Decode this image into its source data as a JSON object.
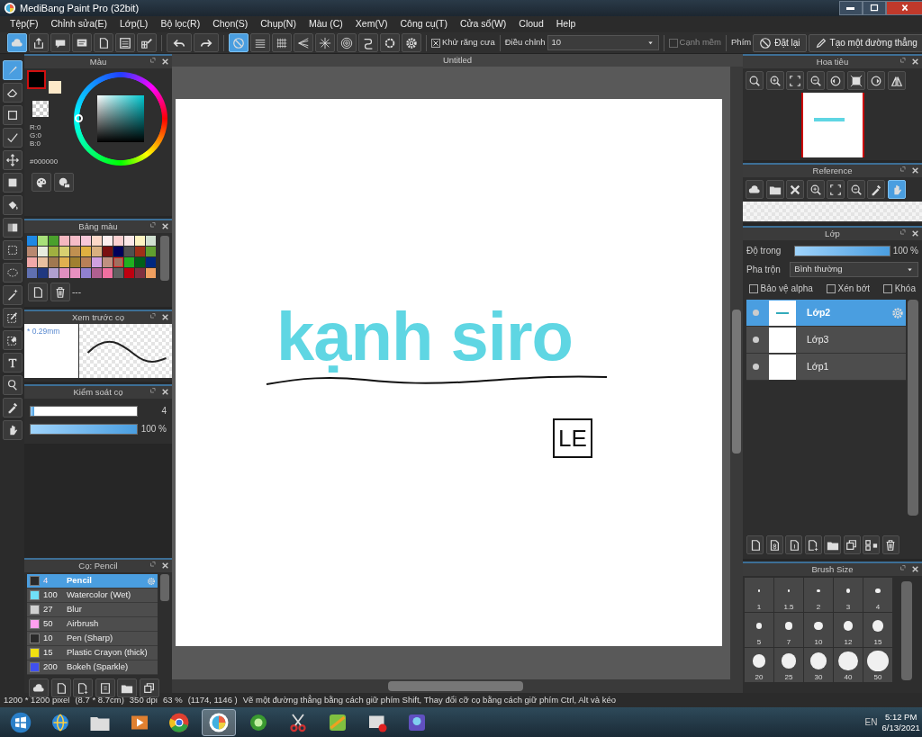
{
  "window": {
    "title": "MediBang Paint Pro (32bit)"
  },
  "menu": [
    "Tệp(F)",
    "Chỉnh sửa(E)",
    "Lớp(L)",
    "Bộ lọc(R)",
    "Chọn(S)",
    "Chụp(N)",
    "Màu (C)",
    "Xem(V)",
    "Công cụ(T)",
    "Cửa sổ(W)",
    "Cloud",
    "Help"
  ],
  "toolbar": {
    "file_tools": [
      {
        "kind": "cloud",
        "selected": true
      },
      {
        "kind": "share",
        "selected": false
      },
      {
        "kind": "speech-bubble",
        "selected": false
      },
      {
        "kind": "chat",
        "selected": false
      },
      {
        "kind": "document",
        "selected": false
      },
      {
        "kind": "list",
        "selected": false
      },
      {
        "kind": "grid-pencil",
        "selected": false
      }
    ],
    "history": [
      {
        "kind": "undo"
      },
      {
        "kind": "redo"
      }
    ],
    "snaps": [
      {
        "kind": "no-snap",
        "selected": true
      },
      {
        "kind": "parallel-lines",
        "selected": false
      },
      {
        "kind": "grid",
        "selected": false
      },
      {
        "kind": "perspective",
        "selected": false
      },
      {
        "kind": "radial",
        "selected": false
      },
      {
        "kind": "concentric",
        "selected": false
      },
      {
        "kind": "curve",
        "selected": false
      },
      {
        "kind": "circle",
        "selected": false
      },
      {
        "kind": "gear",
        "selected": false
      }
    ],
    "antialias": {
      "label": "Khử răng cưa",
      "checked": true
    },
    "correction": {
      "label": "Điều chỉnh",
      "value": "10"
    },
    "soft_edge": {
      "label": "Cạnh mềm",
      "checked": false
    },
    "keys_label": "Phím",
    "buttons": [
      {
        "kind": "no-snap",
        "label": "Đặt lại"
      },
      {
        "kind": "pen",
        "label": "Tạo một đường thẳng"
      }
    ]
  },
  "tools": [
    {
      "kind": "brush",
      "selected": true
    },
    {
      "kind": "eraser",
      "selected": false
    },
    {
      "kind": "square",
      "selected": false
    },
    {
      "kind": "polyline",
      "selected": false
    },
    {
      "kind": "move-arrows",
      "selected": false
    },
    {
      "kind": "filled-square",
      "selected": false
    },
    {
      "kind": "paint-bucket",
      "selected": false
    },
    {
      "kind": "gradient",
      "selected": false
    },
    {
      "kind": "dashed-rectangle",
      "selected": false
    },
    {
      "kind": "lasso",
      "selected": false
    },
    {
      "kind": "magic-wand",
      "selected": false
    },
    {
      "kind": "selection-pen",
      "selected": false
    },
    {
      "kind": "selection-eraser",
      "selected": false
    },
    {
      "kind": "text-tool",
      "selected": false
    },
    {
      "kind": "pointer",
      "selected": false
    },
    {
      "kind": "eyedropper",
      "selected": false
    },
    {
      "kind": "hand",
      "selected": false
    }
  ],
  "color_panel": {
    "title": "Màu",
    "swatches": [
      {
        "color": "#000000",
        "selected": true
      },
      {
        "color": "#fde8c8",
        "selected": false
      }
    ],
    "r": "R:0",
    "g": "G:0",
    "b": "B:0",
    "hex": "#000000",
    "buttons": [
      {
        "kind": "palette"
      },
      {
        "kind": "palette-settings"
      }
    ]
  },
  "palette": {
    "title": "Bảng màu",
    "footer": "---",
    "colors": [
      {
        "color": "#1e88e5",
        "selected": false
      },
      {
        "color": "#a8e07a",
        "selected": false
      },
      {
        "color": "#4aa02c",
        "selected": false
      },
      {
        "color": "#f4b8c0",
        "selected": false
      },
      {
        "color": "#f6bcc8",
        "selected": false
      },
      {
        "color": "#f7c8d8",
        "selected": false
      },
      {
        "color": "#fcd8c8",
        "selected": false
      },
      {
        "color": "#fdeeee",
        "selected": false
      },
      {
        "color": "#fbd0d0",
        "selected": false
      },
      {
        "color": "#fce8e8",
        "selected": false
      },
      {
        "color": "#fdf3c0",
        "selected": false
      },
      {
        "color": "#d0e0d0",
        "selected": false
      },
      {
        "color": "#b88870",
        "selected": false
      },
      {
        "color": "#e8ece0",
        "selected": false
      },
      {
        "color": "#a0b040",
        "selected": false
      },
      {
        "color": "#d8d070",
        "selected": false
      },
      {
        "color": "#c09050",
        "selected": false
      },
      {
        "color": "#e0b040",
        "selected": false
      },
      {
        "color": "#d8b080",
        "selected": false
      },
      {
        "color": "#7a1010",
        "selected": false
      },
      {
        "color": "#00005a",
        "selected": false
      },
      {
        "color": "#505050",
        "selected": false
      },
      {
        "color": "#a03018",
        "selected": false
      },
      {
        "color": "#60a030",
        "selected": false
      },
      {
        "color": "#f0a8a8",
        "selected": false
      },
      {
        "color": "#e8c0a0",
        "selected": false
      },
      {
        "color": "#a07850",
        "selected": false
      },
      {
        "color": "#e0b050",
        "selected": false
      },
      {
        "color": "#a08030",
        "selected": false
      },
      {
        "color": "#b88058",
        "selected": false
      },
      {
        "color": "#d0a0e0",
        "selected": false
      },
      {
        "color": "#c09080",
        "selected": false
      },
      {
        "color": "#a07060",
        "selected": true
      },
      {
        "color": "#20b020",
        "selected": false
      },
      {
        "color": "#006018",
        "selected": false
      },
      {
        "color": "#002880",
        "selected": false
      },
      {
        "color": "#6070b0",
        "selected": false
      },
      {
        "color": "#203880",
        "selected": false
      },
      {
        "color": "#b0a0d0",
        "selected": false
      },
      {
        "color": "#e090c0",
        "selected": false
      },
      {
        "color": "#e890c0",
        "selected": false
      },
      {
        "color": "#9080d0",
        "selected": false
      },
      {
        "color": "#b06090",
        "selected": false
      },
      {
        "color": "#f070a0",
        "selected": false
      },
      {
        "color": "#606060",
        "selected": false
      },
      {
        "color": "#c00010",
        "selected": false
      },
      {
        "color": "#803040",
        "selected": false
      },
      {
        "color": "#f0a060",
        "selected": false
      }
    ]
  },
  "brush_preview": {
    "title": "Xem trước cọ",
    "size": "* 0.29mm"
  },
  "brush_control": {
    "title": "Kiểm soát cọ",
    "sliders": [
      {
        "level": 0.03,
        "reading": "4"
      },
      {
        "level": 1,
        "reading": "100 %"
      }
    ]
  },
  "brush_list": {
    "title": "Cọ: Pencil",
    "items": [
      {
        "color": "#2a2a2a",
        "size": "4",
        "name": "Pencil",
        "selected": true
      },
      {
        "color": "#70e0f8",
        "size": "100",
        "name": "Watercolor (Wet)",
        "selected": false
      },
      {
        "color": "#d0d0d0",
        "size": "27",
        "name": "Blur",
        "selected": false
      },
      {
        "color": "#ffa0f0",
        "size": "50",
        "name": "Airbrush",
        "selected": false
      },
      {
        "color": "#2a2a2a",
        "size": "10",
        "name": "Pen (Sharp)",
        "selected": false
      },
      {
        "color": "#f0e010",
        "size": "15",
        "name": "Plastic Crayon (thick)",
        "selected": false
      },
      {
        "color": "#4050f0",
        "size": "200",
        "name": "Bokeh (Sparkle)",
        "selected": false
      }
    ],
    "footer": [
      {
        "kind": "cloud"
      },
      {
        "kind": "document"
      },
      {
        "kind": "add-document"
      },
      {
        "kind": "script"
      },
      {
        "kind": "folder"
      },
      {
        "kind": "duplicate"
      }
    ]
  },
  "document": {
    "tab": "Untitled",
    "art_text": "kạnh siro",
    "mark": "LE"
  },
  "navigator": {
    "title": "Hoa tiêu",
    "tools": [
      {
        "kind": "zoom"
      },
      {
        "kind": "zoom-in"
      },
      {
        "kind": "fit-screen"
      },
      {
        "kind": "zoom-out"
      },
      {
        "kind": "rotate-left"
      },
      {
        "kind": "fullscreen"
      },
      {
        "kind": "rotate-right"
      },
      {
        "kind": "flip"
      }
    ]
  },
  "reference": {
    "title": "Reference",
    "tools": [
      {
        "kind": "cloud",
        "selected": false
      },
      {
        "kind": "folder",
        "selected": false
      },
      {
        "kind": "close",
        "selected": false
      },
      {
        "kind": "zoom-in",
        "selected": false
      },
      {
        "kind": "fit-screen",
        "selected": false
      },
      {
        "kind": "zoom-out",
        "selected": false
      },
      {
        "kind": "eyedropper",
        "selected": false
      },
      {
        "kind": "hand",
        "selected": true
      }
    ]
  },
  "layers_panel": {
    "title": "Lớp",
    "opacity": {
      "label": "Độ trong",
      "level": 1,
      "reading": "100 %"
    },
    "blend": {
      "label": "Pha trộn",
      "value": "Bình thường"
    },
    "options": [
      {
        "label": "Bảo vệ alpha",
        "checked": false
      },
      {
        "label": "Xén bớt",
        "checked": false
      },
      {
        "label": "Khóa",
        "checked": false
      }
    ],
    "layers": [
      {
        "name": "Lớp2",
        "selected": true,
        "visible": true,
        "kind": "art"
      },
      {
        "name": "Lớp3",
        "selected": false,
        "visible": true,
        "kind": "blank"
      },
      {
        "name": "Lớp1",
        "selected": false,
        "visible": true,
        "kind": "blank"
      }
    ],
    "footer": [
      {
        "kind": "document"
      },
      {
        "kind": "document-8"
      },
      {
        "kind": "document-1"
      },
      {
        "kind": "add-document"
      },
      {
        "kind": "folder"
      },
      {
        "kind": "duplicate"
      },
      {
        "kind": "merge"
      },
      {
        "kind": "trash"
      }
    ]
  },
  "brush_size": {
    "title": "Brush Size",
    "sizes": [
      "1",
      "1.5",
      "2",
      "3",
      "4",
      "5",
      "7",
      "10",
      "12",
      "15",
      "20",
      "25",
      "30",
      "40",
      "50"
    ]
  },
  "status_bar": {
    "fields": [
      "1200 * 1200 pixel",
      "(8.7 * 8.7cm)",
      "350 dpi",
      "63 %",
      "(1174, 1146 )"
    ],
    "message": "Vẽ một đường thẳng bằng cách giữ phím Shift, Thay đổi cỡ cọ bằng cách giữ phím Ctrl, Alt và kéo"
  },
  "taskbar": {
    "apps": [
      {
        "kind": "start",
        "selected": false
      },
      {
        "kind": "globe",
        "selected": false
      },
      {
        "kind": "folder",
        "selected": false
      },
      {
        "kind": "play",
        "selected": false
      },
      {
        "kind": "chrome",
        "selected": false
      },
      {
        "kind": "paint-app",
        "selected": true
      },
      {
        "kind": "disc-app",
        "selected": false
      },
      {
        "kind": "scissors",
        "selected": false
      },
      {
        "kind": "game",
        "selected": false
      },
      {
        "kind": "record",
        "selected": false
      },
      {
        "kind": "character",
        "selected": false
      }
    ],
    "language": "EN",
    "time": "5:12 PM",
    "date": "6/13/2021"
  }
}
